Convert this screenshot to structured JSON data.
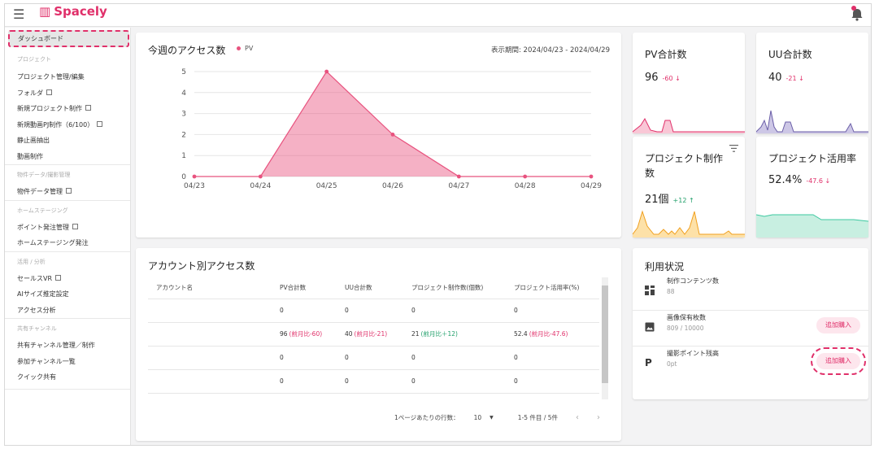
{
  "header": {
    "logo_text": "Spacely",
    "menu_icon": "menu-icon",
    "notification_icon": "bell-icon"
  },
  "sidebar": {
    "active": "ダッシュボード",
    "groups": [
      {
        "section": "プロジェクト",
        "items": [
          {
            "label": "プロジェクト管理/編集",
            "external": false
          },
          {
            "label": "フォルダ",
            "external": true
          },
          {
            "label": "新規プロジェクト制作",
            "external": true
          },
          {
            "label": "新規動画PJ制作（6/100）",
            "external": true
          },
          {
            "label": "静止画抽出",
            "external": false
          },
          {
            "label": "動画制作",
            "external": false
          }
        ]
      },
      {
        "section": "物件データ/撮影管理",
        "items": [
          {
            "label": "物件データ管理",
            "external": true
          }
        ]
      },
      {
        "section": "ホームステージング",
        "items": [
          {
            "label": "ポイント発注管理",
            "external": true
          },
          {
            "label": "ホームステージング発注",
            "external": false
          }
        ]
      },
      {
        "section": "活用 / 分析",
        "items": [
          {
            "label": "セールスVR",
            "external": true
          },
          {
            "label": "AIサイズ推定設定",
            "external": false
          },
          {
            "label": "アクセス分析",
            "external": false
          }
        ]
      },
      {
        "section": "共有チャンネル",
        "items": [
          {
            "label": "共有チャンネル管理／制作",
            "external": false
          },
          {
            "label": "参加チャンネル一覧",
            "external": false
          },
          {
            "label": "クイック共有",
            "external": false
          }
        ]
      }
    ]
  },
  "weekly": {
    "title": "今週のアクセス数",
    "legend": "PV",
    "period": "表示期間: 2024/04/23 - 2024/04/29",
    "color": "#e8537f"
  },
  "chart_data": {
    "type": "area",
    "title": "今週のアクセス数",
    "categories": [
      "04/23",
      "04/24",
      "04/25",
      "04/26",
      "04/27",
      "04/28",
      "04/29"
    ],
    "series": [
      {
        "name": "PV",
        "values": [
          0,
          0,
          5,
          2,
          0,
          0,
          0
        ]
      }
    ],
    "ylim": [
      0,
      5
    ],
    "yticks": [
      0,
      1,
      2,
      3,
      4,
      5
    ],
    "legend": "top-left",
    "grid": true
  },
  "stats": {
    "pv": {
      "title": "PV合計数",
      "value": "96",
      "delta": "-60 ↓",
      "color": "#e0306a"
    },
    "uu": {
      "title": "UU合計数",
      "value": "40",
      "delta": "-21 ↓",
      "color": "#7a6fb0"
    },
    "projects": {
      "title_line1": "プロジェクト制作",
      "title_line2": "数",
      "value": "21個",
      "delta": "+12 ↑",
      "color": "#f0a020"
    },
    "rate": {
      "title": "プロジェクト活用率",
      "value": "52.4%",
      "delta": "-47.6 ↓",
      "color": "#3cc8a0"
    }
  },
  "account_table": {
    "title": "アカウント別アクセス数",
    "columns": [
      "アカウント名",
      "PV合計数",
      "UU合計数",
      "プロジェクト制作数(個数)",
      "プロジェクト活用率(%)"
    ],
    "rows": [
      {
        "name": "",
        "pv": "0",
        "pv_delta": "",
        "uu": "0",
        "uu_delta": "",
        "proj": "0",
        "proj_delta": "",
        "rate": "0",
        "rate_delta": ""
      },
      {
        "name": "",
        "pv": "96",
        "pv_delta": "(前月比-60)",
        "uu": "40",
        "uu_delta": "(前月比-21)",
        "proj": "21",
        "proj_delta": "(前月比＋12)",
        "rate": "52.4",
        "rate_delta": "(前月比-47.6)"
      },
      {
        "name": "",
        "pv": "0",
        "pv_delta": "",
        "uu": "0",
        "uu_delta": "",
        "proj": "0",
        "proj_delta": "",
        "rate": "0",
        "rate_delta": ""
      },
      {
        "name": "",
        "pv": "0",
        "pv_delta": "",
        "uu": "0",
        "uu_delta": "",
        "proj": "0",
        "proj_delta": "",
        "rate": "0",
        "rate_delta": ""
      }
    ],
    "rows_per_page_label": "1ページあたりの行数：",
    "rows_per_page": "10",
    "range": "1-5 件目 / 5件"
  },
  "usage": {
    "title": "利用状況",
    "items": [
      {
        "label": "制作コンテンツ数",
        "value": "88",
        "icon": "dashboard-grid-icon",
        "button": ""
      },
      {
        "label": "画像保有枚数",
        "value": "809 / 10000",
        "icon": "image-icon",
        "button": "追加購入"
      },
      {
        "label": "撮影ポイント残高",
        "value": "0pt",
        "icon": "points-icon",
        "button": "追加購入"
      }
    ]
  }
}
